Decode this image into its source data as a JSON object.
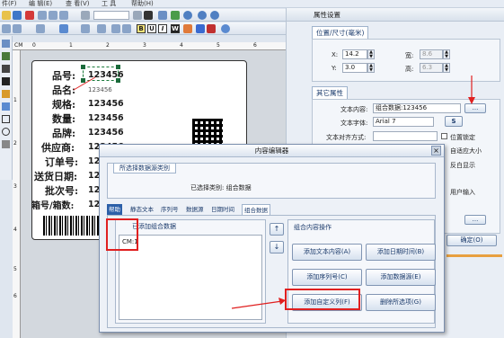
{
  "menubar": {
    "items": [
      "件(F)",
      "编 辑(E)",
      "查 看(V)",
      "工 具",
      "帮助(H)"
    ]
  },
  "toolbar": {
    "bold": "B",
    "underline": "U",
    "italic": "I",
    "w": "W"
  },
  "ruler": {
    "unit": "CM",
    "h_ticks": [
      "0",
      "1",
      "2",
      "3",
      "4",
      "5",
      "6"
    ],
    "v_ticks": [
      "1",
      "2",
      "3",
      "4",
      "5",
      "6"
    ]
  },
  "label": {
    "rows": [
      {
        "name": "品号:",
        "value": "123456"
      },
      {
        "name": "品名:",
        "value": "123456"
      },
      {
        "name": "规格:",
        "value": "123456"
      },
      {
        "name": "数量:",
        "value": "123456"
      },
      {
        "name": "品牌:",
        "value": "123456"
      },
      {
        "name": "供应商:",
        "value": "123456"
      },
      {
        "name": "订单号:",
        "value": "12"
      },
      {
        "name": "送货日期:",
        "value": "12"
      },
      {
        "name": "批次号:",
        "value": "12"
      },
      {
        "name": "箱号/箱数:",
        "value": "12"
      }
    ]
  },
  "props": {
    "title": "属性设置",
    "tab_pos": "位置/尺寸(毫米)",
    "x_label": "X:",
    "x_val": "14.2",
    "y_label": "Y:",
    "y_val": "3.0",
    "w_label": "宽:",
    "w_val": "8.6",
    "h_label": "高:",
    "h_val": "6.3",
    "tab_other": "其它属性",
    "content_label": "文本内容:",
    "content_val": "组合数据:123456",
    "font_label": "文本字体:",
    "font_val": "Arial 7",
    "align_label": "文本对齐方式:",
    "lock_label": "位置锁定",
    "auto_label": "自适应大小",
    "reverse_label": "反白显示",
    "user_input_label": "用户输入",
    "ellipsis": "...",
    "s_btn": "S",
    "ok_btn": "确定(O)"
  },
  "dialog": {
    "title": "内容编辑器",
    "group_title": "所选择数据源类别",
    "selected_text": "已选择类别:  组合数据",
    "tabs": [
      "帮助",
      "静态文本",
      "序列号",
      "数据源",
      "日期时间",
      "组合数据"
    ],
    "added_title": "已添加组合数据",
    "list_items": [
      "CM:1"
    ],
    "ops_title": "组合内容操作",
    "btn_text": "添加文本内容(A)",
    "btn_date": "添加日期时间(B)",
    "btn_serial": "添加序列号(C)",
    "btn_source": "添加数据源(E)",
    "btn_custom": "添加自定义列(F)",
    "btn_delete": "删除所选项(G)",
    "up": "↑",
    "down": "↓",
    "close": "×"
  },
  "colors": {
    "accent": "#2b5fa8",
    "highlight": "#e02020"
  }
}
